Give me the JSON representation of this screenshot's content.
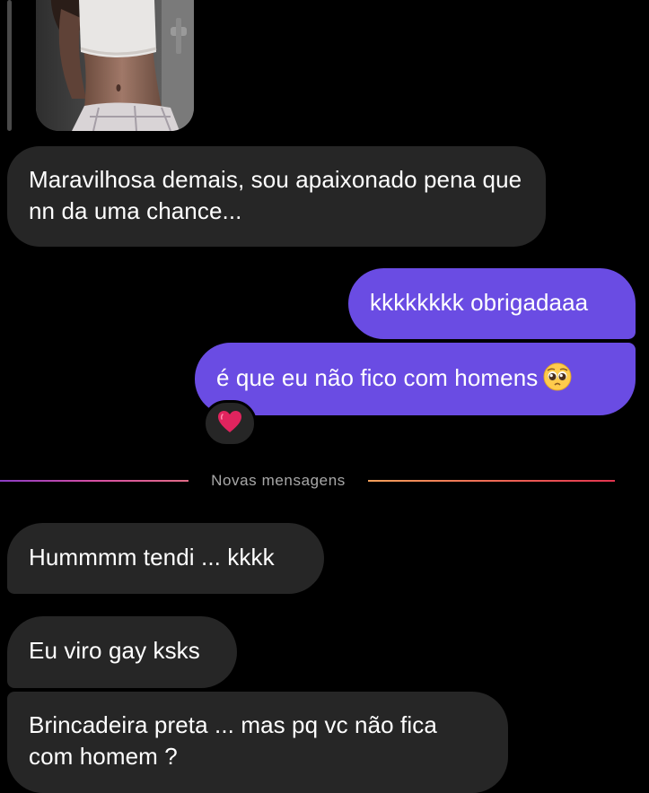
{
  "conversation": {
    "messages": [
      {
        "sender": "them",
        "text": "Maravilhosa demais, sou apaixonado pena que nn da uma chance..."
      },
      {
        "sender": "me",
        "text": "kkkkkkkk obrigadaaa"
      },
      {
        "sender": "me",
        "text": "é que eu não fico com homens",
        "emoji": "pleading-face-emoji",
        "reaction": "red-heart"
      },
      {
        "sender": "them",
        "text": "Hummmm tendi ... kkkk"
      },
      {
        "sender": "them",
        "text": "Eu viro gay ksks"
      },
      {
        "sender": "them",
        "text": "Brincadeira preta ... mas pq vc não fica com homem ?"
      }
    ],
    "divider_label": "Novas mensagens"
  },
  "colors": {
    "background": "#000000",
    "incoming_bubble": "#262626",
    "outgoing_bubble": "#6a4ce3",
    "divider_text": "#a8a8a8",
    "reaction_heart": "#e0245e"
  },
  "icons": {
    "reaction": "heart-icon",
    "emoji": "pleading-face-icon"
  }
}
